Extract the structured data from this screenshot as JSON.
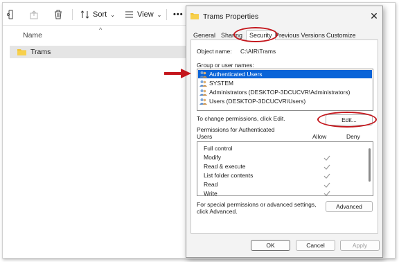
{
  "explorer": {
    "toolbar": {
      "sort_label": "Sort",
      "view_label": "View",
      "more_label": "•••"
    },
    "column_header": "Name",
    "folder_name": "Trams"
  },
  "dialog": {
    "title": "Trams Properties",
    "tabs": [
      "General",
      "Sharing",
      "Security",
      "Previous Versions",
      "Customize"
    ],
    "active_tab": "Security",
    "object_name_label": "Object name:",
    "object_name_value": "C:\\AIR\\Trams",
    "group_label": "Group or user names:",
    "users": [
      "Authenticated Users",
      "SYSTEM",
      "Administrators (DESKTOP-3DCUCVR\\Administrators)",
      "Users (DESKTOP-3DCUCVR\\Users)"
    ],
    "selected_user_index": 0,
    "change_hint": "To change permissions, click Edit.",
    "edit_button": "Edit...",
    "permissions_for_line1": "Permissions for Authenticated",
    "permissions_for_line2": "Users",
    "allow_header": "Allow",
    "deny_header": "Deny",
    "permissions": [
      {
        "name": "Full control",
        "allow": false
      },
      {
        "name": "Modify",
        "allow": true
      },
      {
        "name": "Read & execute",
        "allow": true
      },
      {
        "name": "List folder contents",
        "allow": true
      },
      {
        "name": "Read",
        "allow": true
      },
      {
        "name": "Write",
        "allow": true
      }
    ],
    "special_line1": "For special permissions or advanced settings,",
    "special_line2": "click Advanced.",
    "advanced_button": "Advanced",
    "ok_button": "OK",
    "cancel_button": "Cancel",
    "apply_button": "Apply"
  },
  "colors": {
    "selection": "#0a64d8",
    "annotation_red": "#c4161c",
    "check_gray": "#9a9a9a"
  }
}
